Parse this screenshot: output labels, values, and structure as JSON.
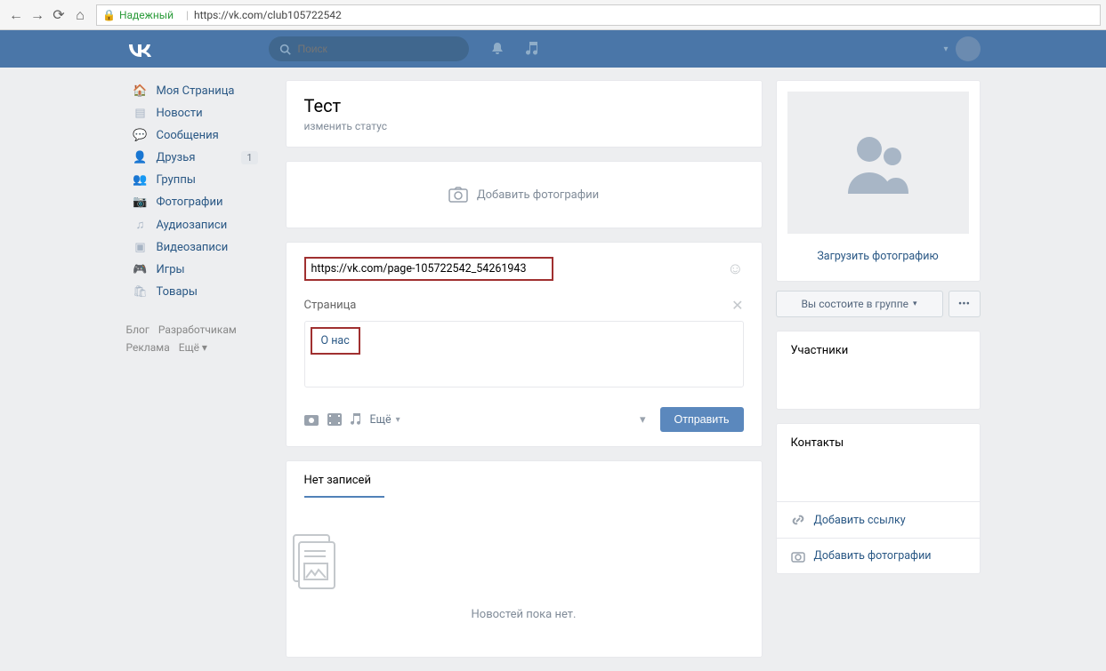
{
  "browser": {
    "trusted": "Надежный",
    "url_sep": "|",
    "url": "https://vk.com/club105722542"
  },
  "search": {
    "placeholder": "Поиск"
  },
  "sidebar": {
    "items": [
      {
        "label": "Моя Страница"
      },
      {
        "label": "Новости"
      },
      {
        "label": "Сообщения"
      },
      {
        "label": "Друзья",
        "badge": "1"
      },
      {
        "label": "Группы"
      },
      {
        "label": "Фотографии"
      },
      {
        "label": "Аудиозаписи"
      },
      {
        "label": "Видеозаписи"
      },
      {
        "label": "Игры"
      },
      {
        "label": "Товары"
      }
    ],
    "footer": {
      "blog": "Блог",
      "dev": "Разработчикам",
      "ads": "Реклама",
      "more": "Ещё ▾"
    }
  },
  "group": {
    "title": "Тест",
    "status": "изменить статус"
  },
  "add_photos": "Добавить фотографии",
  "post": {
    "url": "https://vk.com/page-105722542_54261943",
    "attach_label": "Страница",
    "about": "О нас",
    "more": "Ещё",
    "send": "Отправить"
  },
  "empty": {
    "tab": "Нет записей",
    "text": "Новостей пока нет."
  },
  "right": {
    "upload": "Загрузить фотографию",
    "member": "Вы состоите в группе",
    "participants": "Участники",
    "contacts": "Контакты",
    "add_link": "Добавить ссылку",
    "add_photos": "Добавить фотографии"
  }
}
